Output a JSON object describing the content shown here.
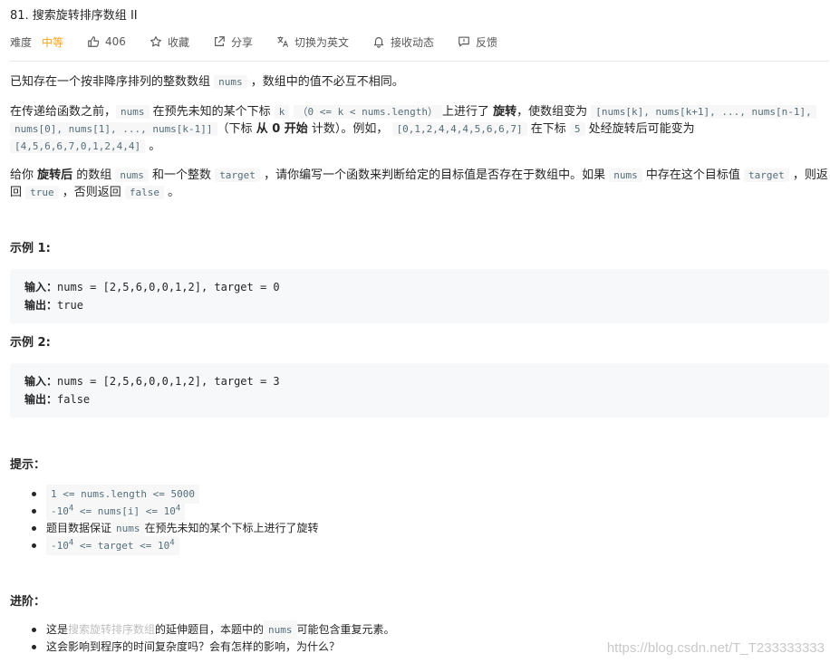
{
  "problem": {
    "title": "81. 搜索旋转排序数组 II",
    "difficulty_label": "难度",
    "difficulty_value": "中等",
    "likes": "406",
    "favorite_label": "收藏",
    "share_label": "分享",
    "switch_lang_label": "切换为英文",
    "subscribe_label": "接收动态",
    "feedback_label": "反馈"
  },
  "description": {
    "p1_a": "已知存在一个按非降序排列的整数数组 ",
    "p1_code": "nums",
    "p1_b": " ，数组中的值不必互不相同。",
    "p2_a": "在传递给函数之前，",
    "p2_code_nums": "nums",
    "p2_b": " 在预先未知的某个下标 ",
    "p2_code_k": "k",
    "p2_code_range": "（0 <= k < nums.length）",
    "p2_c": "上进行了 ",
    "p2_bold_rotate": "旋转",
    "p2_d": "，使数组变为 ",
    "p2_code_arr1": "[nums[k], nums[k+1], ..., nums[n-1],",
    "p2_code_arr2": "nums[0], nums[1], ..., nums[k-1]]",
    "p2_e": "（下标 ",
    "p2_bold_zero": "从 0 开始",
    "p2_f": " 计数）。例如， ",
    "p2_code_example": "[0,1,2,4,4,4,5,6,6,7]",
    "p2_g": " 在下标 ",
    "p2_code_five": "5",
    "p2_h": " 处经旋转后可能变为",
    "p2_code_result": "[4,5,6,6,7,0,1,2,4,4]",
    "p2_i": " 。",
    "p3_a": "给你 ",
    "p3_bold": "旋转后",
    "p3_b": " 的数组 ",
    "p3_code_nums": "nums",
    "p3_c": " 和一个整数 ",
    "p3_code_target": "target",
    "p3_d": " ，请你编写一个函数来判断给定的目标值是否存在于数组中。如果 ",
    "p3_code_nums2": "nums",
    "p3_e": " 中存在这个目标值 ",
    "p3_code_target2": "target",
    "p3_f": " ，则返",
    "p3_g": "回 ",
    "p3_code_true": "true",
    "p3_h": " ，否则返回 ",
    "p3_code_false": "false",
    "p3_i": " 。"
  },
  "examples": [
    {
      "heading": "示例 1:",
      "input_label": "输入：",
      "input_value": "nums = [2,5,6,0,0,1,2], target = 0",
      "output_label": "输出：",
      "output_value": "true"
    },
    {
      "heading": "示例 2:",
      "input_label": "输入：",
      "input_value": "nums = [2,5,6,0,0,1,2], target = 3",
      "output_label": "输出：",
      "output_value": "false"
    }
  ],
  "hints": {
    "heading": "提示：",
    "item1": "1 <= nums.length <= 5000",
    "item2_a": "-10",
    "item2_sup1": "4",
    "item2_b": " <= nums[i] <= 10",
    "item2_sup2": "4",
    "item3_a": "题目数据保证 ",
    "item3_code": "nums",
    "item3_b": " 在预先未知的某个下标上进行了旋转",
    "item4_a": "-10",
    "item4_sup1": "4",
    "item4_b": " <= target <= 10",
    "item4_sup2": "4"
  },
  "advanced": {
    "heading": "进阶：",
    "item1_a": "这是 ",
    "item1_link": "搜索旋转排序数组",
    "item1_b": " 的延伸题目，本题中的 ",
    "item1_code": "nums",
    "item1_c": " 可能包含重复元素。",
    "item2": "这会影响到程序的时间复杂度吗？会有怎样的影响，为什么？"
  },
  "watermark": "https://blog.csdn.net/T_T233333333",
  "colors": {
    "difficulty_medium": "#ffa116",
    "code_bg": "#f7f7f7",
    "pre_bg": "#f7f8fa"
  },
  "icons": [
    "thumbs-up-icon",
    "star-icon",
    "share-icon",
    "translate-icon",
    "bell-icon",
    "feedback-icon"
  ]
}
